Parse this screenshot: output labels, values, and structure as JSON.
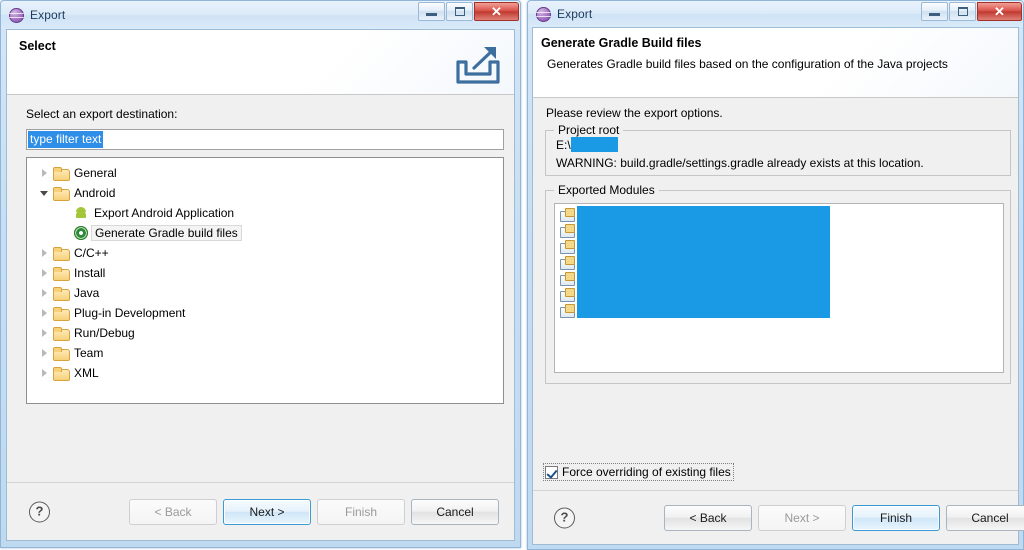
{
  "left_dialog": {
    "window": {
      "title": "Export",
      "icon": "eclipse-sphere-icon",
      "minimize_label": "Minimize",
      "maximize_label": "Maximize",
      "close_label": "✕"
    },
    "banner": {
      "title": "Select",
      "icon": "export-arrow-icon"
    },
    "destination_label": "Select an export destination:",
    "filter": {
      "value": "type filter text",
      "placeholder": "type filter text"
    },
    "tree": [
      {
        "label": "General",
        "icon": "folder-icon",
        "expander": "collapsed",
        "level": 0,
        "selected": false
      },
      {
        "label": "Android",
        "icon": "folder-icon",
        "expander": "expanded",
        "level": 0,
        "selected": false
      },
      {
        "label": "Export Android Application",
        "icon": "android-icon",
        "expander": "none",
        "level": 1,
        "selected": false
      },
      {
        "label": "Generate Gradle build files",
        "icon": "gradle-icon",
        "expander": "none",
        "level": 1,
        "selected": true
      },
      {
        "label": "C/C++",
        "icon": "folder-icon",
        "expander": "collapsed",
        "level": 0,
        "selected": false
      },
      {
        "label": "Install",
        "icon": "folder-icon",
        "expander": "collapsed",
        "level": 0,
        "selected": false
      },
      {
        "label": "Java",
        "icon": "folder-icon",
        "expander": "collapsed",
        "level": 0,
        "selected": false
      },
      {
        "label": "Plug-in Development",
        "icon": "folder-icon",
        "expander": "collapsed",
        "level": 0,
        "selected": false
      },
      {
        "label": "Run/Debug",
        "icon": "folder-icon",
        "expander": "collapsed",
        "level": 0,
        "selected": false
      },
      {
        "label": "Team",
        "icon": "folder-icon",
        "expander": "collapsed",
        "level": 0,
        "selected": false
      },
      {
        "label": "XML",
        "icon": "folder-icon",
        "expander": "collapsed",
        "level": 0,
        "selected": false
      }
    ],
    "buttons": {
      "help": "?",
      "back": "< Back",
      "next": "Next >",
      "finish": "Finish",
      "cancel": "Cancel"
    }
  },
  "right_dialog": {
    "window": {
      "title": "Export",
      "icon": "eclipse-sphere-icon",
      "close_label": "✕"
    },
    "banner": {
      "title": "Generate Gradle Build files",
      "subtitle": "Generates Gradle build files based on the configuration of the Java projects"
    },
    "review_text": "Please review the export options.",
    "project_root": {
      "group_label": "Project root",
      "path_prefix": "E:\\",
      "path_redacted": true,
      "warning": "WARNING: build.gradle/settings.gradle already exists at this location."
    },
    "exported_modules": {
      "group_label": "Exported Modules",
      "rows": [
        {
          "icon": "project-icon",
          "redacted": true
        },
        {
          "icon": "project-icon",
          "redacted": true
        },
        {
          "icon": "project-icon",
          "redacted": true
        },
        {
          "icon": "project-icon",
          "redacted": true
        },
        {
          "icon": "project-icon",
          "redacted": true
        },
        {
          "icon": "project-icon",
          "redacted": true
        },
        {
          "icon": "project-icon",
          "redacted": true
        }
      ]
    },
    "force_override": {
      "label": "Force overriding of existing files",
      "checked": true
    },
    "buttons": {
      "help": "?",
      "back": "< Back",
      "next": "Next >",
      "finish": "Finish",
      "cancel": "Cancel"
    }
  },
  "colors": {
    "redaction_blue": "#1a9ae5",
    "selection_blue": "#2f8fe8",
    "titlebar_blue": "#cfe3f6",
    "dialog_gray": "#f0f0f0",
    "close_red": "#bf3a30"
  }
}
